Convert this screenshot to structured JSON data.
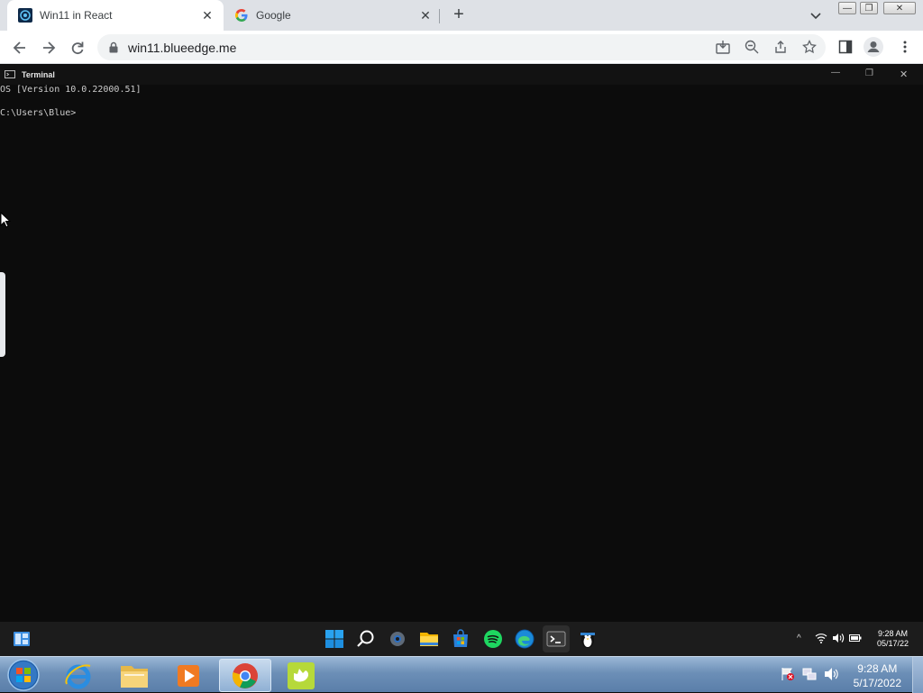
{
  "browser": {
    "tabs": [
      {
        "label": "Win11 in React",
        "icon": "win11-react-icon",
        "active": true
      },
      {
        "label": "Google",
        "icon": "google-g-icon",
        "active": false
      }
    ],
    "url": "win11.blueedge.me"
  },
  "terminal": {
    "title": "Terminal",
    "lines": [
      "OS [Version 10.0.22000.51]",
      "C:\\Users\\Blue>"
    ]
  },
  "win11_taskbar": {
    "time": "9:28 AM",
    "date": "05/17/22",
    "apps": [
      "start-icon",
      "search-icon",
      "settings-icon",
      "file-explorer-icon",
      "store-icon",
      "spotify-icon",
      "edge-icon",
      "terminal-icon",
      "penguin-icon"
    ]
  },
  "win7_taskbar": {
    "time": "9:28 AM",
    "date": "5/17/2022"
  },
  "colors": {
    "terminal_bg": "#0c0c0c",
    "win11_taskbar_bg": "#1c1c1c",
    "chrome_tabstrip": "#dee1e6"
  }
}
